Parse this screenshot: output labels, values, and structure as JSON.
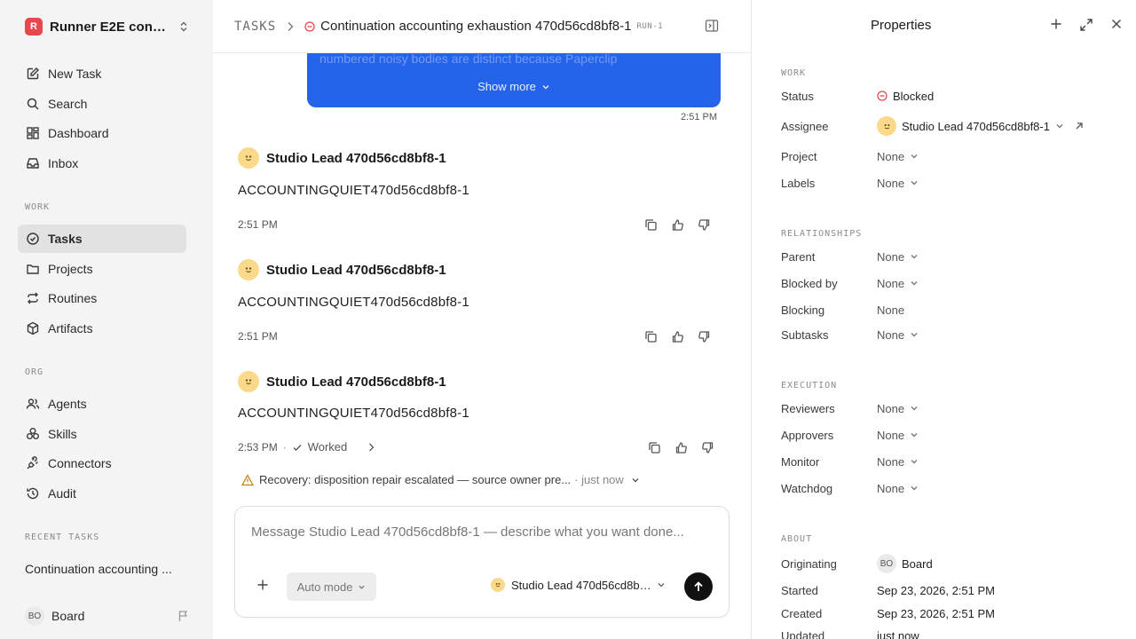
{
  "sidebar": {
    "workspace": {
      "initial": "R",
      "name": "Runner E2E conti..."
    },
    "nav": [
      {
        "label": "New Task"
      },
      {
        "label": "Search"
      },
      {
        "label": "Dashboard"
      },
      {
        "label": "Inbox"
      }
    ],
    "work_section": "WORK",
    "work": [
      {
        "label": "Tasks"
      },
      {
        "label": "Projects"
      },
      {
        "label": "Routines"
      },
      {
        "label": "Artifacts"
      }
    ],
    "org_section": "ORG",
    "org": [
      {
        "label": "Agents"
      },
      {
        "label": "Skills"
      },
      {
        "label": "Connectors"
      },
      {
        "label": "Audit"
      }
    ],
    "recent_section": "RECENT TASKS",
    "recent": [
      "Continuation accounting ..."
    ],
    "user": {
      "initials": "BO",
      "name": "Board"
    }
  },
  "header": {
    "root": "TASKS",
    "title": "Continuation accounting exhaustion 470d56cd8bf8-1",
    "run": "RUN-1"
  },
  "thread": {
    "bubble": {
      "text": "numbered noisy bodies are distinct because Paperclip",
      "show_more": "Show more",
      "time": "2:51 PM"
    },
    "messages": [
      {
        "author": "Studio Lead 470d56cd8bf8-1",
        "body": "ACCOUNTINGQUIET470d56cd8bf8-1",
        "time": "2:51 PM"
      },
      {
        "author": "Studio Lead 470d56cd8bf8-1",
        "body": "ACCOUNTINGQUIET470d56cd8bf8-1",
        "time": "2:51 PM"
      },
      {
        "author": "Studio Lead 470d56cd8bf8-1",
        "body": "ACCOUNTINGQUIET470d56cd8bf8-1",
        "time": "2:53 PM",
        "worked": "Worked",
        "sep": "·"
      }
    ],
    "recovery": {
      "text": "Recovery: disposition repair escalated — source owner pre...",
      "when": "· just now"
    }
  },
  "composer": {
    "placeholder": "Message Studio Lead 470d56cd8bf8-1 — describe what you want done...",
    "mode": "Auto mode",
    "agent": "Studio Lead 470d56cd8bf8-1"
  },
  "properties": {
    "title": "Properties",
    "work_section": "WORK",
    "status_label": "Status",
    "status": "Blocked",
    "assignee_label": "Assignee",
    "assignee": "Studio Lead 470d56cd8bf8-1",
    "project_label": "Project",
    "project": "None",
    "labels_label": "Labels",
    "labels": "None",
    "rel_section": "RELATIONSHIPS",
    "parent_label": "Parent",
    "parent": "None",
    "blocked_by_label": "Blocked by",
    "blocked_by": "None",
    "blocking_label": "Blocking",
    "blocking": "None",
    "subtasks_label": "Subtasks",
    "subtasks": "None",
    "exec_section": "EXECUTION",
    "reviewers_label": "Reviewers",
    "reviewers": "None",
    "approvers_label": "Approvers",
    "approvers": "None",
    "monitor_label": "Monitor",
    "monitor": "None",
    "watchdog_label": "Watchdog",
    "watchdog": "None",
    "about_section": "ABOUT",
    "originating_label": "Originating",
    "originating_initials": "BO",
    "originating": "Board",
    "started_label": "Started",
    "started": "Sep 23, 2026, 2:51 PM",
    "created_label": "Created",
    "created": "Sep 23, 2026, 2:51 PM",
    "updated_label": "Updated",
    "updated": "just now"
  },
  "colors": {
    "accent": "#2563eb",
    "blocked": "#e5484d",
    "warning": "#c2851a"
  }
}
